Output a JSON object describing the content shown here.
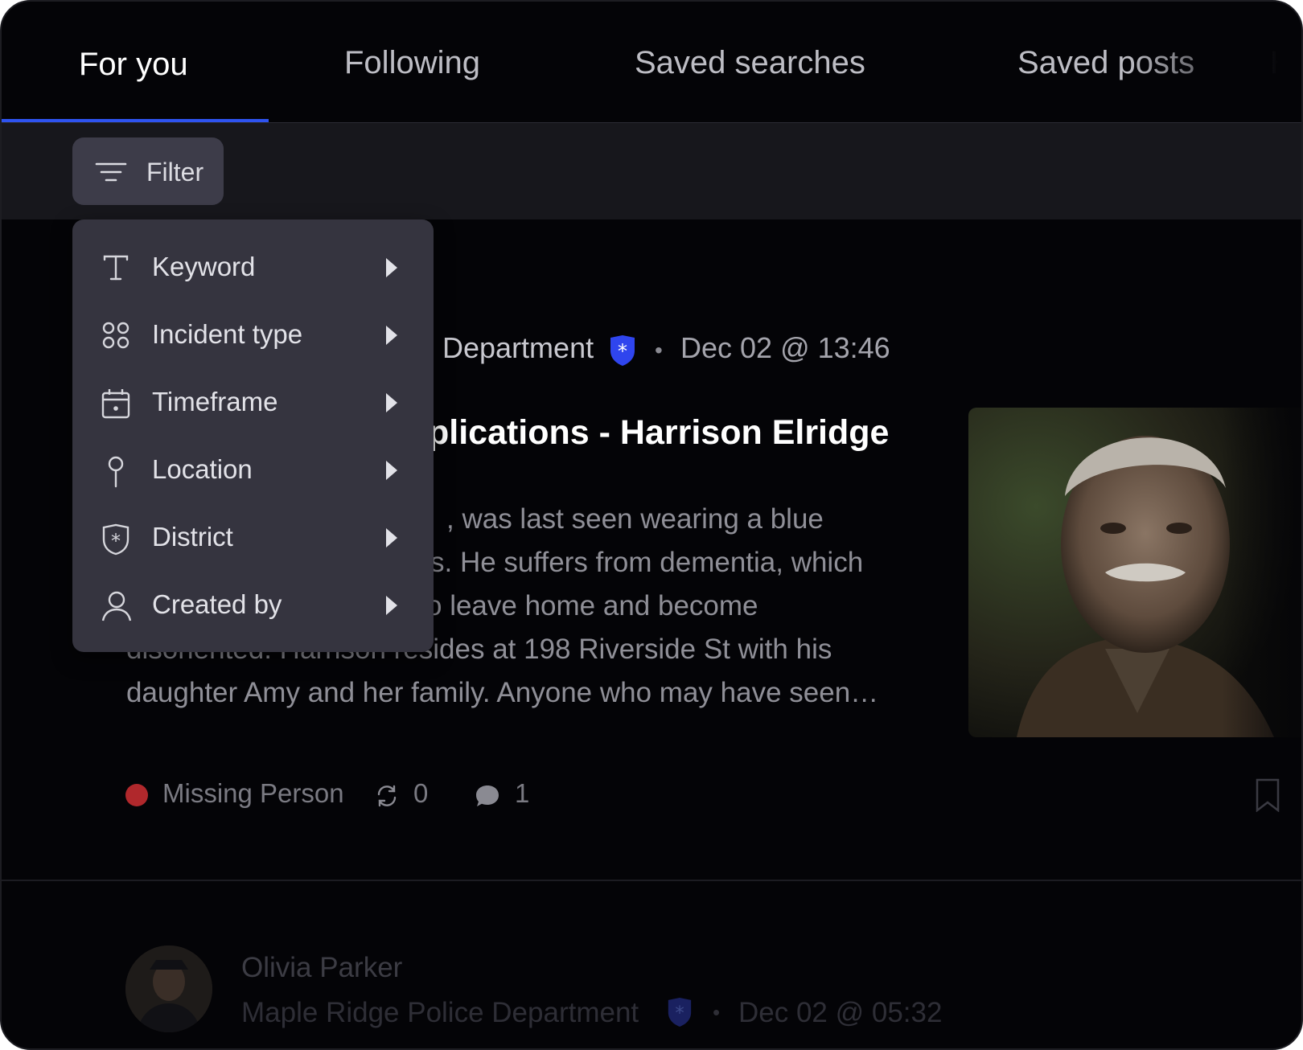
{
  "tabs": [
    {
      "label": "For you",
      "active": true
    },
    {
      "label": "Following"
    },
    {
      "label": "Saved searches"
    },
    {
      "label": "Saved posts"
    },
    {
      "label": "H"
    }
  ],
  "filter": {
    "label": "Filter"
  },
  "filter_menu": {
    "items": [
      {
        "label": "Keyword",
        "icon": "text-icon"
      },
      {
        "label": "Incident type",
        "icon": "grid-circles-icon"
      },
      {
        "label": "Timeframe",
        "icon": "calendar-icon"
      },
      {
        "label": "Location",
        "icon": "pin-icon"
      },
      {
        "label": "District",
        "icon": "shield-star-icon"
      },
      {
        "label": "Created by",
        "icon": "user-icon"
      }
    ]
  },
  "post1": {
    "department_partial": "Department",
    "separator": "•",
    "timestamp": "Dec 02 @ 13:46",
    "title_partial": "plications - Harrison Elridge",
    "body_lines": [
      ", was last seen wearing a blue",
      "s. He suffers from dementia, which",
      "o leave home and become",
      "disoriented. Harrison resides at 198 Riverside St with his",
      "daughter Amy and her family. Anyone who may have seen…"
    ],
    "category": "Missing Person",
    "category_color": "#b0282c",
    "reposts": "0",
    "comments": "1"
  },
  "post2": {
    "author": "Olivia Parker",
    "department": "Maple Ridge Police Department",
    "separator": "•",
    "timestamp": "Dec 02 @ 05:32"
  },
  "colors": {
    "accent": "#2e53f0",
    "badge": "#2f45ee"
  }
}
